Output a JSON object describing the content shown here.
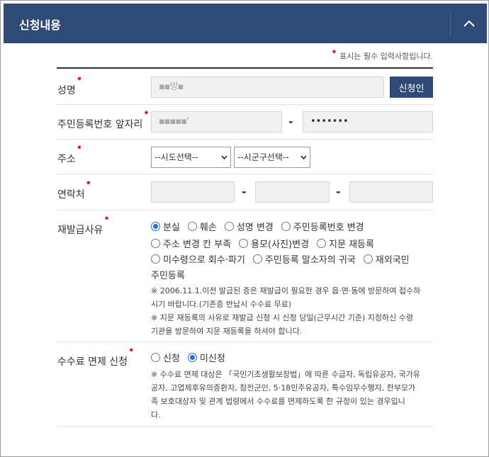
{
  "header": {
    "title": "신청내용"
  },
  "required_note": "표시는 필수 입력사항입니다.",
  "rows": {
    "name": {
      "label": "성명",
      "value": "▪▪방▪",
      "button": "신청인"
    },
    "rrn": {
      "label": "주민등록번호 앞자리",
      "front": "▪▪▪▪▪'",
      "back": "•••••••",
      "sep": "-"
    },
    "address": {
      "label": "주소",
      "sido": "--시도선택--",
      "sigungu": "--시군구선택--"
    },
    "contact": {
      "label": "연락처",
      "sep": "-"
    },
    "reason": {
      "label": "재발급사유",
      "options": [
        "분실",
        "훼손",
        "성명 변경",
        "주민등록번호 변경",
        "주소 변경 칸 부족",
        "용모(사진)변경",
        "지문 재등록",
        "미수령으로 회수·파기",
        "주민등록 말소자의 귀국",
        "재외국민",
        "주민등록"
      ],
      "selected": 0,
      "notes": [
        "※ 2006.11.1.이전 발급된 증은 재발급이 필요한 경우 읍·면·동에 방문하여 접수하",
        "시기 바랍니다.(기존증 반납시 수수료 무료)",
        "※ 지문 재등록의 사유로 재발급 신청 시 신청 당일(근무시간 기준) 지정하신 수령",
        "기관을 방문하여 지문 재등록을 하셔야 합니다."
      ]
    },
    "fee": {
      "label": "수수료 면제 신청",
      "options": [
        "신청",
        "미신청"
      ],
      "selected": 1,
      "notes": [
        "※ 수수료 면제 대상은 「국민기초생활보장법」에 따른 수급자, 독립유공자, 국가유",
        "공자, 고엽제후유의증환자, 참전군인, 5·18민주유공자, 특수임무수행자, 한부모가",
        "족 보호대상자 및 관계 법령에서 수수료를 면제하도록 한 규정이 있는 경우입니",
        "다."
      ]
    }
  },
  "colors": {
    "header_bg": "#2f4a77",
    "required": "#d9262e",
    "radio_on": "#1a73e8"
  }
}
